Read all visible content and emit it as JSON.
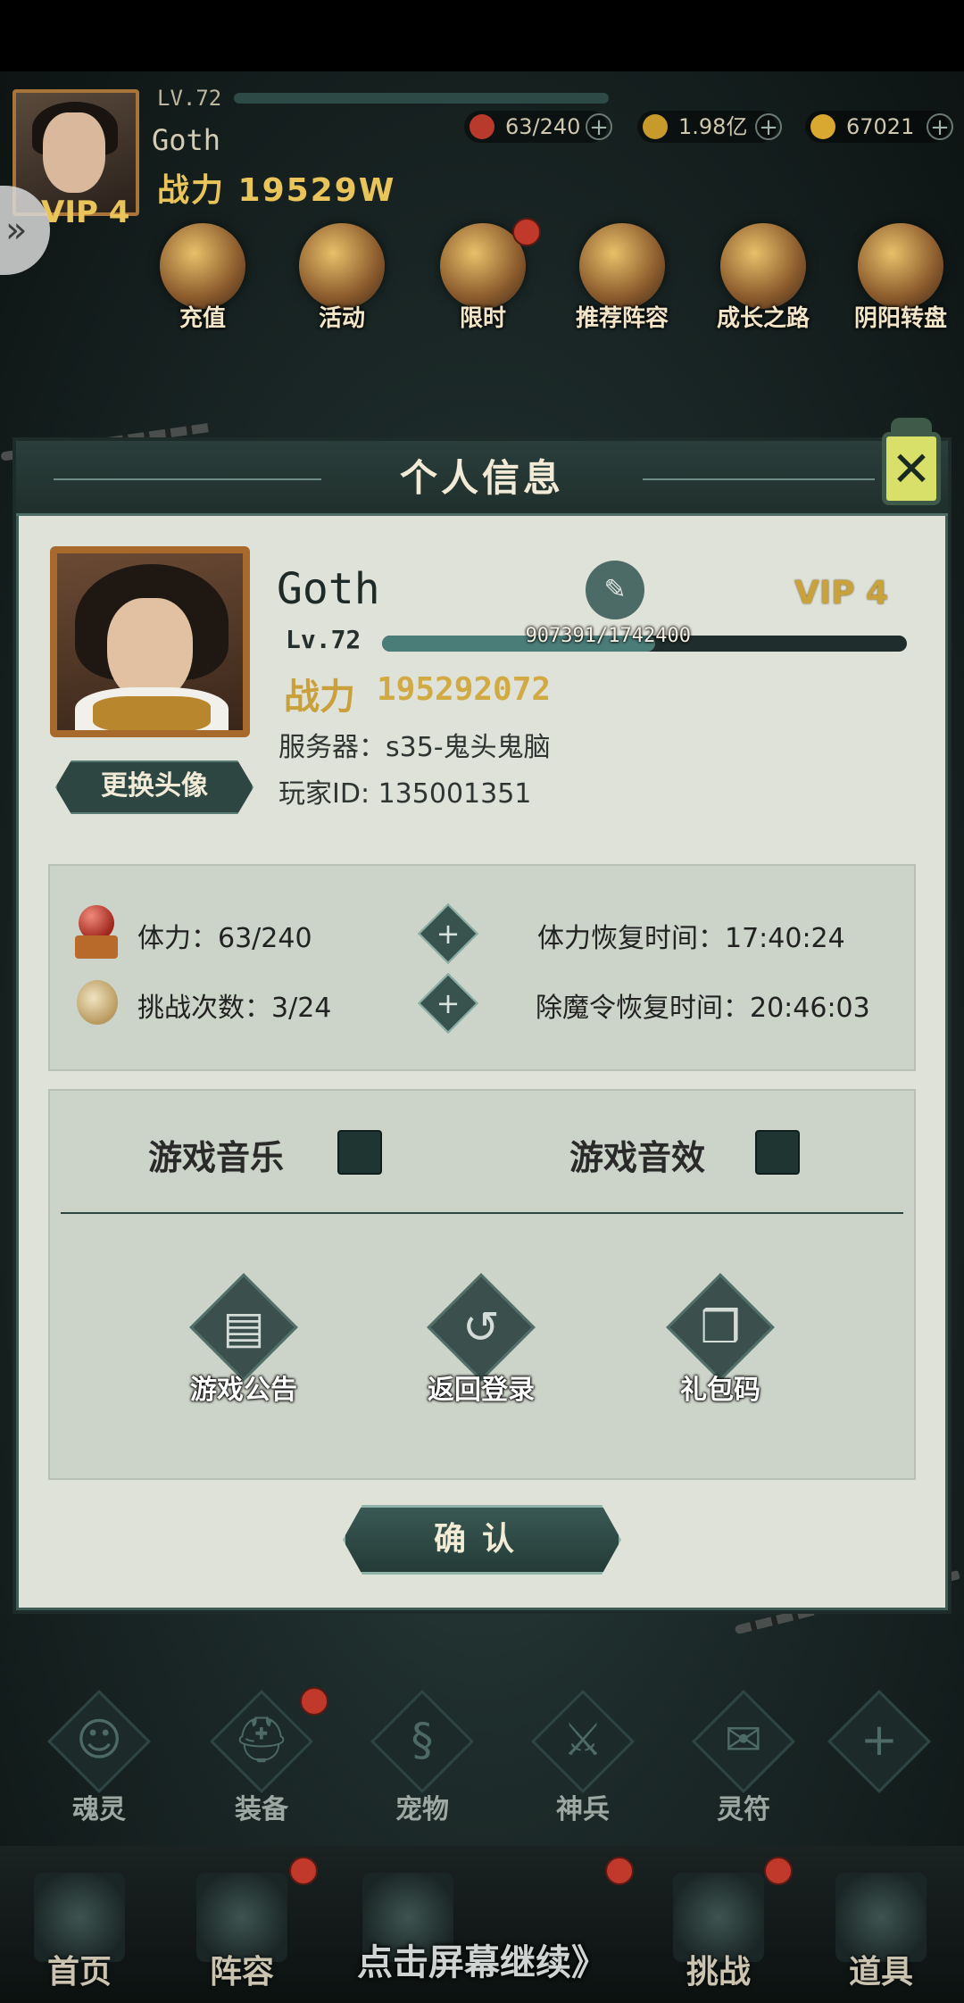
{
  "hud": {
    "level": "LV.72",
    "name": "Goth",
    "power": "战力 19529W",
    "vip": "VIP 4",
    "resources": {
      "stamina": "63/240",
      "coins": "1.98亿",
      "ingots": "67021"
    }
  },
  "top_icons": [
    "充值",
    "活动",
    "限时",
    "推荐阵容",
    "成长之路",
    "阴阳转盘"
  ],
  "dialog": {
    "title": "个人信息",
    "close_icon": "close-x-icon",
    "profile": {
      "name": "Goth",
      "vip": "VIP 4",
      "level": "Lv.72",
      "exp_text": "907391/1742400",
      "exp_progress": 0.5208,
      "power_label": "战力",
      "power_value": "195292072",
      "server": "服务器：s35-鬼头鬼脑",
      "player_id": "玩家ID:  135001351",
      "change_avatar": "更换头像"
    },
    "stats": {
      "stamina": "体力：63/240",
      "challenges": "挑战次数：3/24",
      "stamina_recover": "体力恢复时间：17:40:24",
      "demon_recover": "除魔令恢复时间：20:46:03"
    },
    "settings": {
      "music_label": "游戏音乐",
      "sfx_label": "游戏音效",
      "music_on": false,
      "sfx_on": false
    },
    "actions": {
      "notice": "游戏公告",
      "relogin": "返回登录",
      "giftcode": "礼包码"
    },
    "confirm": "确认"
  },
  "bottom_functions": [
    "魂灵",
    "装备",
    "宠物",
    "神兵",
    "灵符"
  ],
  "bottom_tabs": [
    "首页",
    "阵容",
    "挑战",
    "道具"
  ],
  "tap_to_continue": "点击屏幕继续》",
  "colors": {
    "dialog_bg": "#dfe2d8",
    "panel_bg": "#ccd3c8",
    "accent_gold": "#caa23b",
    "header_dark": "#2b3e3b",
    "checkbox": "#1e3532"
  }
}
